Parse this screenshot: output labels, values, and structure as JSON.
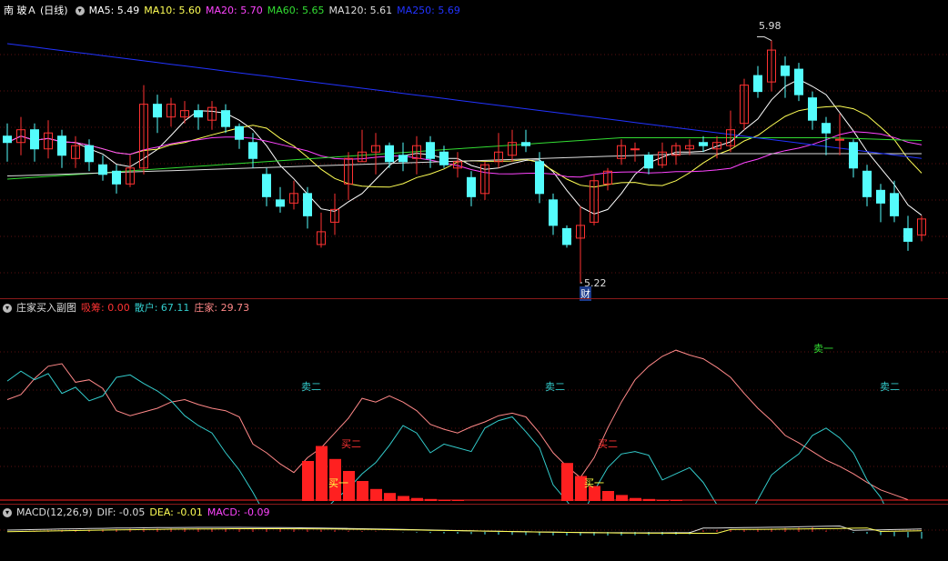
{
  "main": {
    "title": "南 玻Ａ (日线)",
    "ma": [
      {
        "label": "MA5: 5.49",
        "color": "#ffffff"
      },
      {
        "label": "MA10: 5.60",
        "color": "#ffff55"
      },
      {
        "label": "MA20: 5.70",
        "color": "#ff44ff"
      },
      {
        "label": "MA60: 5.65",
        "color": "#33dd33"
      },
      {
        "label": "MA120: 5.61",
        "color": "#dddddd"
      },
      {
        "label": "MA250: 5.69",
        "color": "#2233ff"
      }
    ],
    "high_label": "5.98",
    "low_label": "5.22",
    "fin_marker": "财"
  },
  "sub": {
    "title": "庄家买入副图",
    "items": [
      {
        "label": "吸筹: 0.00",
        "color": "#ff3333"
      },
      {
        "label": "散户: 67.11",
        "color": "#33cccc"
      },
      {
        "label": "庄家: 29.73",
        "color": "#ff8888"
      }
    ],
    "signals": [
      {
        "text": "卖二",
        "color": "#33cccc"
      },
      {
        "text": "买二",
        "color": "#ff3333"
      },
      {
        "text": "买一",
        "color": "#ffff44"
      },
      {
        "text": "卖二",
        "color": "#33cccc"
      },
      {
        "text": "买二",
        "color": "#ff3333"
      },
      {
        "text": "买一",
        "color": "#ffff44"
      },
      {
        "text": "卖一",
        "color": "#33dd33"
      },
      {
        "text": "卖二",
        "color": "#33cccc"
      }
    ]
  },
  "macd": {
    "title": "MACD(12,26,9)",
    "items": [
      {
        "label": "DIF: -0.05",
        "color": "#dddddd"
      },
      {
        "label": "DEA: -0.01",
        "color": "#ffff55"
      },
      {
        "label": "MACD: -0.09",
        "color": "#ff44ff"
      }
    ]
  },
  "colors": {
    "up": "#ff3232",
    "down": "#54fcfc",
    "separator": "#8a1a1a",
    "grid": "#5a1010"
  },
  "candles": [
    [
      5.68,
      5.66,
      5.72,
      5.6
    ],
    [
      5.66,
      5.7,
      5.74,
      5.62
    ],
    [
      5.7,
      5.64,
      5.72,
      5.6
    ],
    [
      5.64,
      5.69,
      5.73,
      5.61
    ],
    [
      5.68,
      5.62,
      5.7,
      5.58
    ],
    [
      5.61,
      5.65,
      5.68,
      5.58
    ],
    [
      5.65,
      5.6,
      5.67,
      5.57
    ],
    [
      5.59,
      5.56,
      5.62,
      5.54
    ],
    [
      5.57,
      5.53,
      5.59,
      5.5
    ],
    [
      5.53,
      5.58,
      5.62,
      5.52
    ],
    [
      5.58,
      5.78,
      5.84,
      5.56
    ],
    [
      5.78,
      5.74,
      5.81,
      5.69
    ],
    [
      5.74,
      5.78,
      5.8,
      5.71
    ],
    [
      5.74,
      5.76,
      5.79,
      5.72
    ],
    [
      5.76,
      5.74,
      5.78,
      5.7
    ],
    [
      5.73,
      5.77,
      5.79,
      5.7
    ],
    [
      5.76,
      5.71,
      5.78,
      5.69
    ],
    [
      5.71,
      5.67,
      5.72,
      5.64
    ],
    [
      5.66,
      5.61,
      5.69,
      5.58
    ],
    [
      5.56,
      5.49,
      5.58,
      5.46
    ],
    [
      5.48,
      5.46,
      5.52,
      5.44
    ],
    [
      5.47,
      5.5,
      5.54,
      5.45
    ],
    [
      5.5,
      5.43,
      5.52,
      5.39
    ],
    [
      5.34,
      5.38,
      5.44,
      5.33
    ],
    [
      5.41,
      5.45,
      5.5,
      5.37
    ],
    [
      5.53,
      5.61,
      5.63,
      5.48
    ],
    [
      5.6,
      5.63,
      5.7,
      5.6
    ],
    [
      5.63,
      5.65,
      5.69,
      5.56
    ],
    [
      5.65,
      5.6,
      5.66,
      5.58
    ],
    [
      5.62,
      5.6,
      5.66,
      5.57
    ],
    [
      5.61,
      5.65,
      5.68,
      5.56
    ],
    [
      5.66,
      5.61,
      5.68,
      5.58
    ],
    [
      5.63,
      5.59,
      5.65,
      5.58
    ],
    [
      5.58,
      5.6,
      5.63,
      5.55
    ],
    [
      5.55,
      5.49,
      5.57,
      5.46
    ],
    [
      5.5,
      5.59,
      5.6,
      5.48
    ],
    [
      5.6,
      5.63,
      5.69,
      5.58
    ],
    [
      5.62,
      5.66,
      5.7,
      5.6
    ],
    [
      5.66,
      5.65,
      5.7,
      5.63
    ],
    [
      5.6,
      5.5,
      5.63,
      5.47
    ],
    [
      5.48,
      5.4,
      5.5,
      5.37
    ],
    [
      5.39,
      5.34,
      5.4,
      5.33
    ],
    [
      5.36,
      5.4,
      5.46,
      5.22
    ],
    [
      5.41,
      5.54,
      5.56,
      5.4
    ],
    [
      5.53,
      5.57,
      5.58,
      5.51
    ],
    [
      5.61,
      5.65,
      5.67,
      5.59
    ],
    [
      5.64,
      5.64,
      5.66,
      5.6
    ],
    [
      5.62,
      5.58,
      5.63,
      5.56
    ],
    [
      5.59,
      5.63,
      5.66,
      5.58
    ],
    [
      5.62,
      5.65,
      5.66,
      5.59
    ],
    [
      5.64,
      5.65,
      5.67,
      5.62
    ],
    [
      5.66,
      5.65,
      5.68,
      5.63
    ],
    [
      5.64,
      5.66,
      5.68,
      5.61
    ],
    [
      5.65,
      5.7,
      5.76,
      5.63
    ],
    [
      5.72,
      5.84,
      5.86,
      5.7
    ],
    [
      5.87,
      5.82,
      5.9,
      5.8
    ],
    [
      5.85,
      5.95,
      5.98,
      5.82
    ],
    [
      5.9,
      5.87,
      5.93,
      5.8
    ],
    [
      5.89,
      5.81,
      5.91,
      5.79
    ],
    [
      5.8,
      5.73,
      5.82,
      5.7
    ],
    [
      5.72,
      5.69,
      5.74,
      5.62
    ],
    [
      5.67,
      5.67,
      5.75,
      5.62
    ],
    [
      5.66,
      5.58,
      5.67,
      5.55
    ],
    [
      5.57,
      5.49,
      5.59,
      5.46
    ],
    [
      5.51,
      5.47,
      5.53,
      5.41
    ],
    [
      5.5,
      5.43,
      5.54,
      5.41
    ],
    [
      5.39,
      5.35,
      5.43,
      5.32
    ],
    [
      5.37,
      5.42,
      5.43,
      5.35
    ]
  ]
}
